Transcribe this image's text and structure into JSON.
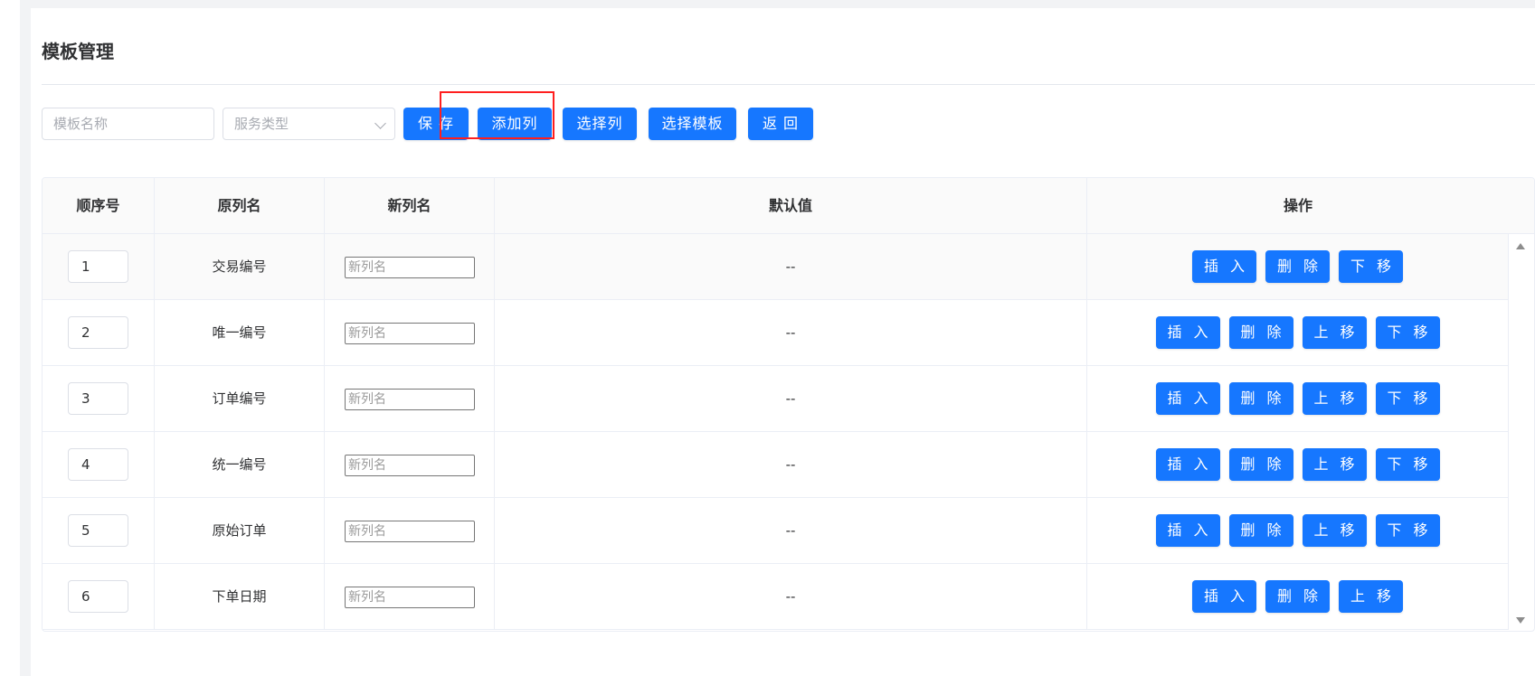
{
  "page": {
    "title": "模板管理"
  },
  "toolbar": {
    "template_name_placeholder": "模板名称",
    "service_type_placeholder": "服务类型",
    "save_label": "保 存",
    "add_column_label": "添加列",
    "select_column_label": "选择列",
    "select_template_label": "选择模板",
    "back_label": "返 回"
  },
  "table": {
    "headers": [
      "顺序号",
      "原列名",
      "新列名",
      "默认值",
      "操作"
    ],
    "new_name_placeholder": "新列名",
    "rows": [
      {
        "seq": "1",
        "original_name": "交易编号",
        "default_value": "--",
        "actions": [
          "插 入",
          "删 除",
          "下 移"
        ]
      },
      {
        "seq": "2",
        "original_name": "唯一编号",
        "default_value": "--",
        "actions": [
          "插 入",
          "删 除",
          "上 移",
          "下 移"
        ]
      },
      {
        "seq": "3",
        "original_name": "订单编号",
        "default_value": "--",
        "actions": [
          "插 入",
          "删 除",
          "上 移",
          "下 移"
        ]
      },
      {
        "seq": "4",
        "original_name": "统一编号",
        "default_value": "--",
        "actions": [
          "插 入",
          "删 除",
          "上 移",
          "下 移"
        ]
      },
      {
        "seq": "5",
        "original_name": "原始订单",
        "default_value": "--",
        "actions": [
          "插 入",
          "删 除",
          "上 移",
          "下 移"
        ]
      },
      {
        "seq": "6",
        "original_name": "下单日期",
        "default_value": "--",
        "actions": [
          "插 入",
          "删 除",
          "上 移"
        ]
      }
    ]
  },
  "colors": {
    "primary": "#1677ff",
    "highlight": "#ff1f1f"
  }
}
